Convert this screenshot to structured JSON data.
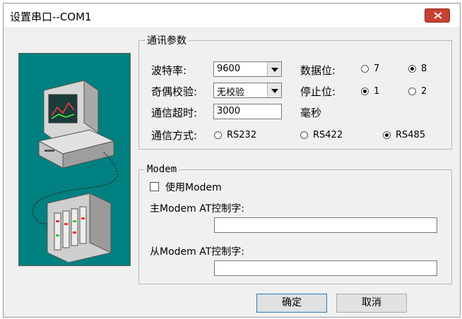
{
  "window": {
    "title": "设置串口--COM1",
    "close_icon": "close-icon"
  },
  "comm_group": {
    "legend": "通讯参数",
    "baud": {
      "label": "波特率:",
      "value": "9600"
    },
    "parity": {
      "label": "奇偶校验:",
      "value": "无校验"
    },
    "timeout": {
      "label": "通信超时:",
      "value": "3000",
      "unit": "毫秒"
    },
    "data_bits": {
      "label": "数据位:",
      "options": [
        "7",
        "8"
      ],
      "selected": "8"
    },
    "stop_bits": {
      "label": "停止位:",
      "options": [
        "1",
        "2"
      ],
      "selected": "1"
    },
    "mode": {
      "label": "通信方式:",
      "options": [
        "RS232",
        "RS422",
        "RS485"
      ],
      "selected": "RS485"
    }
  },
  "modem_group": {
    "legend": "Modem",
    "use_modem_label": "使用Modem",
    "use_modem_checked": false,
    "main_label": "主Modem AT控制字:",
    "main_value": "",
    "slave_label": "从Modem AT控制字:",
    "slave_value": ""
  },
  "buttons": {
    "ok": "确定",
    "cancel": "取消"
  },
  "colors": {
    "art_bg": "#008080",
    "close_red": "#c84031"
  }
}
